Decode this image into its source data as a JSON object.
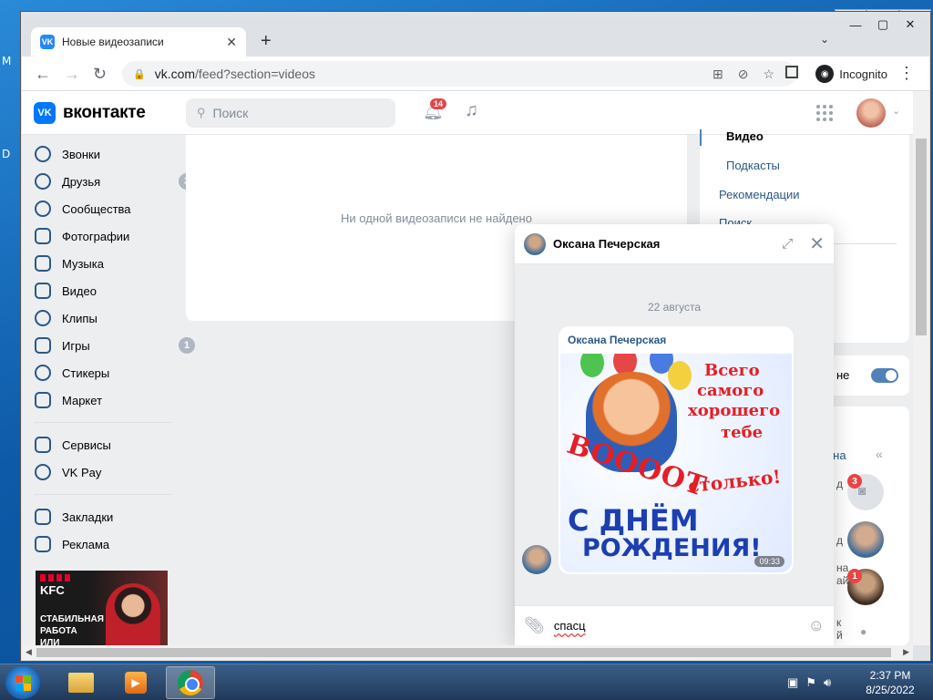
{
  "desktop": {
    "left_letters": [
      "M",
      "D"
    ]
  },
  "window": {
    "ghost_controls": [
      "▭",
      "▢",
      "✕"
    ],
    "controls": [
      "—",
      "▢",
      "✕"
    ]
  },
  "browser": {
    "tab_title": "Новые видеозаписи",
    "tab_favicon": "VK",
    "url_host": "vk.com",
    "url_path": "/feed?section=videos",
    "incognito_label": "Incognito",
    "icons": [
      "translate-icon",
      "eye-off-icon",
      "star-icon",
      "side-panel-icon"
    ]
  },
  "vk": {
    "logo_text": "вконтакте",
    "search_placeholder": "Поиск",
    "notifications_count": "14",
    "menu": [
      {
        "label": "Звонки",
        "badge": ""
      },
      {
        "label": "Друзья",
        "badge": "3"
      },
      {
        "label": "Сообщества",
        "badge": ""
      },
      {
        "label": "Фотографии",
        "badge": ""
      },
      {
        "label": "Музыка",
        "badge": ""
      },
      {
        "label": "Видео",
        "badge": ""
      },
      {
        "label": "Клипы",
        "badge": ""
      },
      {
        "label": "Игры",
        "badge": "1"
      },
      {
        "label": "Стикеры",
        "badge": ""
      },
      {
        "label": "Маркет",
        "badge": ""
      }
    ],
    "menu2": [
      {
        "label": "Сервисы"
      },
      {
        "label": "VK Pay"
      }
    ],
    "menu3": [
      {
        "label": "Закладки"
      },
      {
        "label": "Реклама"
      }
    ],
    "ad": {
      "brand": "KFC",
      "line1": "СТАБИЛЬНАЯ",
      "line2": "РАБОТА",
      "line3": "ИЛИ"
    },
    "empty_message": "Ни одной видеозаписи не найдено",
    "right_menu": {
      "video": "Видео",
      "podcasts": "Подкасты",
      "recommendations": "Рекомендации",
      "search": "Поиск"
    },
    "right_toggle_label": "не",
    "right_partial": {
      "ovna": "овна",
      "chars": [
        "д",
        "д",
        "на",
        "ай",
        "к",
        "й"
      ]
    }
  },
  "chat": {
    "name": "Оксана Печерская",
    "date": "22 августа",
    "message_author": "Оксана Печерская",
    "image_text": {
      "top1": "Всего",
      "top2": "самого",
      "top3": "хорошего",
      "top4": "тебе",
      "voooot": "ВООООТ",
      "stolko": "столько!",
      "s_dnem": "С ДНЁМ",
      "rozhdenia": "РОЖДЕНИЯ!"
    },
    "message_time": "09:33",
    "input_text": "спасц"
  },
  "chat_strip": {
    "badge1": "3",
    "badge2": "1"
  },
  "taskbar": {
    "time": "2:37 PM",
    "date": "8/25/2022"
  }
}
